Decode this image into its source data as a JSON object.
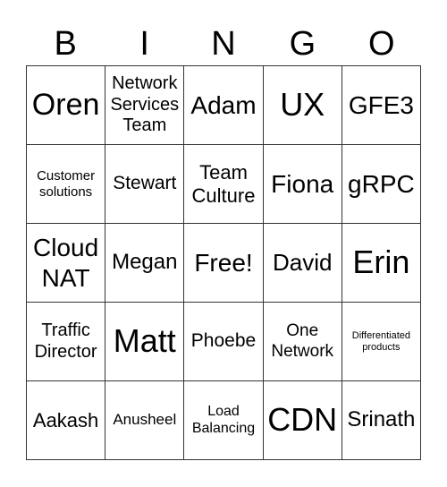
{
  "header": [
    "B",
    "I",
    "N",
    "G",
    "O"
  ],
  "cells": [
    {
      "text": "Oren",
      "size": 34
    },
    {
      "text": "Network Services Team",
      "size": 20
    },
    {
      "text": "Adam",
      "size": 28
    },
    {
      "text": "UX",
      "size": 36
    },
    {
      "text": "GFE3",
      "size": 28
    },
    {
      "text": "Customer solutions",
      "size": 15
    },
    {
      "text": "Stewart",
      "size": 21
    },
    {
      "text": "Team Culture",
      "size": 22
    },
    {
      "text": "Fiona",
      "size": 28
    },
    {
      "text": "gRPC",
      "size": 28
    },
    {
      "text": "Cloud NAT",
      "size": 28
    },
    {
      "text": "Megan",
      "size": 24
    },
    {
      "text": "Free!",
      "size": 28
    },
    {
      "text": "David",
      "size": 26
    },
    {
      "text": "Erin",
      "size": 36
    },
    {
      "text": "Traffic Director",
      "size": 20
    },
    {
      "text": "Matt",
      "size": 36
    },
    {
      "text": "Phoebe",
      "size": 21
    },
    {
      "text": "One Network",
      "size": 19
    },
    {
      "text": "Differentiated products",
      "size": 11
    },
    {
      "text": "Aakash",
      "size": 22
    },
    {
      "text": "Anusheel",
      "size": 17
    },
    {
      "text": "Load Balancing",
      "size": 16
    },
    {
      "text": "CDN",
      "size": 36
    },
    {
      "text": "Srinath",
      "size": 24
    }
  ]
}
